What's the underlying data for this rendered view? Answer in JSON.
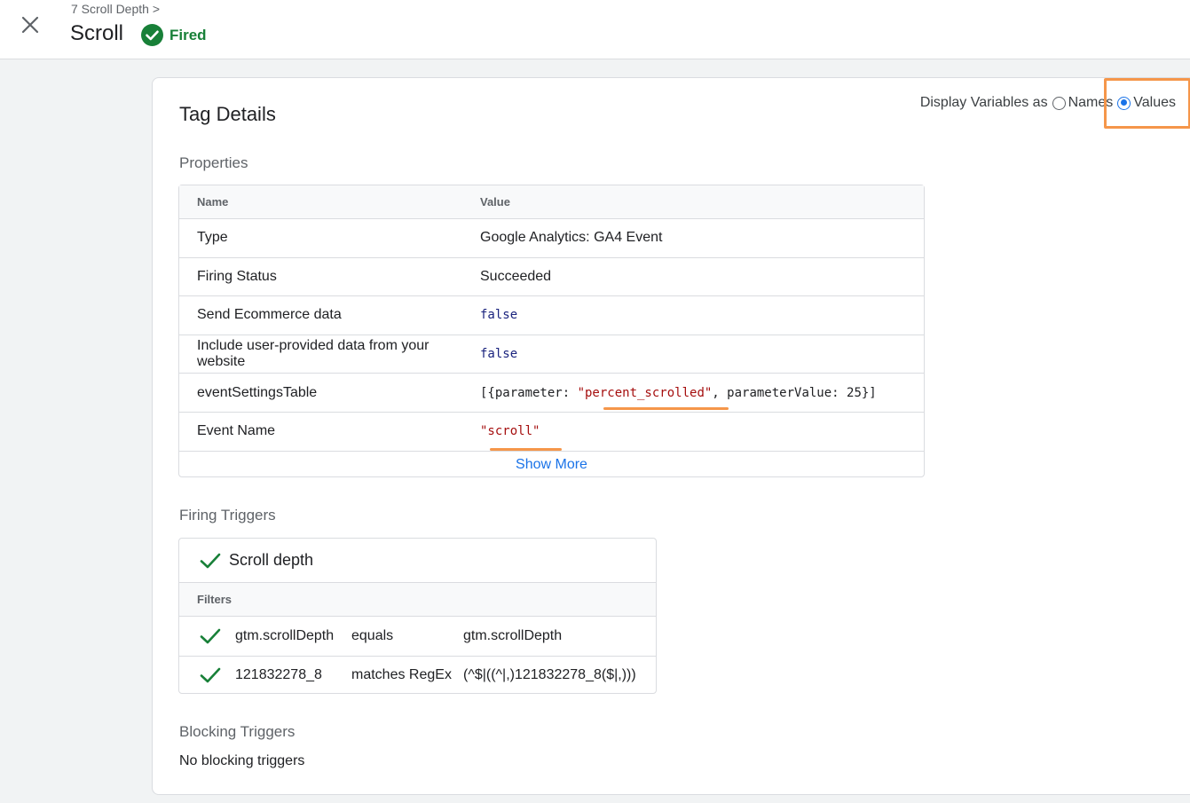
{
  "header": {
    "breadcrumb": "7 Scroll Depth >",
    "title": "Scroll",
    "status": "Fired",
    "status_color": "#188038",
    "close_icon": "close-icon"
  },
  "card": {
    "title": "Tag Details",
    "display_vars": {
      "label": "Display Variables as",
      "options": [
        "Names",
        "Values"
      ],
      "selected": "Values"
    },
    "properties": {
      "section_label": "Properties",
      "columns": [
        "Name",
        "Value"
      ],
      "rows": [
        {
          "name": "Type",
          "value": "Google Analytics: GA4 Event"
        },
        {
          "name": "Firing Status",
          "value": "Succeeded"
        },
        {
          "name": "Send Ecommerce data",
          "value": "false"
        },
        {
          "name": "Include user-provided data from your website",
          "value": "false"
        },
        {
          "name": "eventSettingsTable",
          "value_prefix": "[{parameter: ",
          "value_string": "\"percent_scrolled\"",
          "value_suffix": ", parameterValue: 25}]"
        },
        {
          "name": "Event Name",
          "value": "\"scroll\""
        }
      ],
      "show_more": "Show More"
    },
    "firing_triggers": {
      "section_label": "Firing Triggers",
      "trigger_name": "Scroll depth",
      "filters_label": "Filters",
      "filters": [
        {
          "variable": "gtm.scrollDepth",
          "operator": "equals",
          "value": "gtm.scrollDepth"
        },
        {
          "variable": "121832278_8",
          "operator": "matches RegEx",
          "value": "(^$|((^|,)121832278_8($|,)))"
        }
      ]
    },
    "blocking_triggers": {
      "section_label": "Blocking Triggers",
      "empty_text": "No blocking triggers"
    }
  },
  "colors": {
    "accent": "#1a73e8",
    "highlight": "#f5964a",
    "check": "#188038"
  }
}
